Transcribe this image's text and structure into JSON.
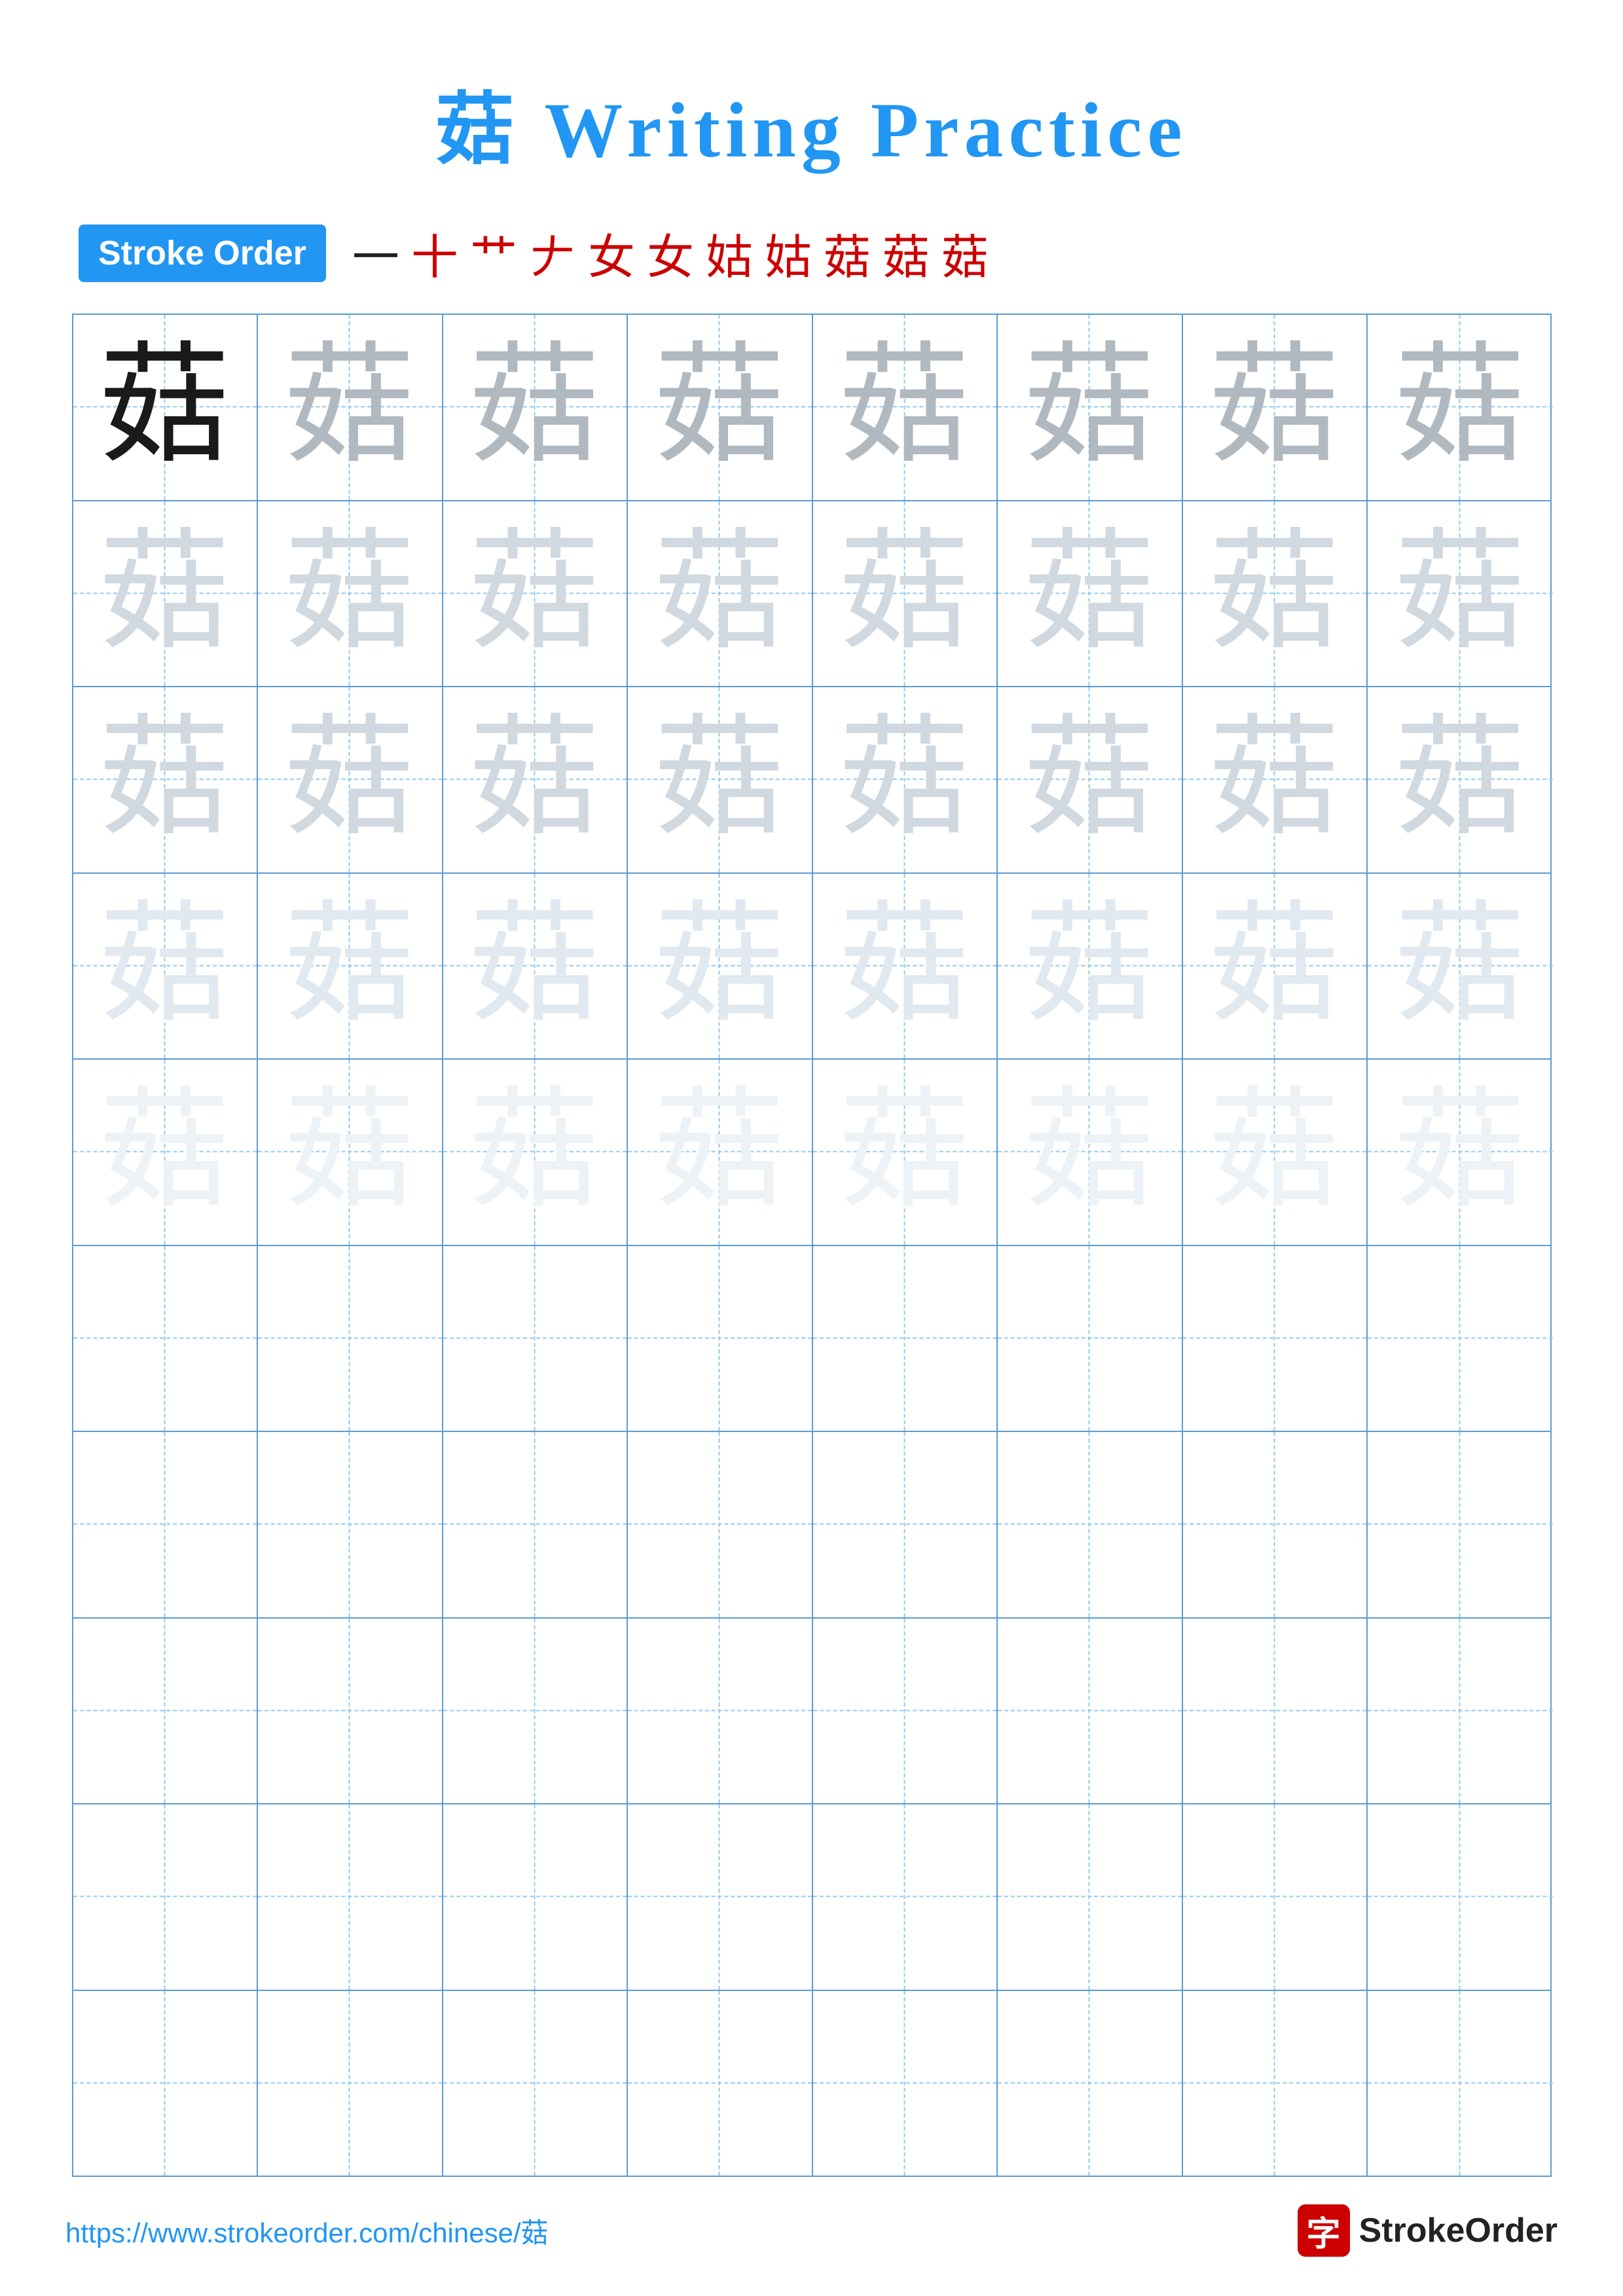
{
  "page": {
    "title": "菇 Writing Practice",
    "character": "菇",
    "stroke_order_label": "Stroke Order",
    "stroke_order_sequence": [
      "一",
      "十",
      "艹",
      "𠂇",
      "女",
      "女",
      "姑",
      "姑",
      "菇",
      "菇",
      "菇"
    ],
    "footer_url": "https://www.strokeorder.com/chinese/菇",
    "footer_logo_char": "字",
    "footer_logo_text": "StrokeOrder",
    "rows": [
      {
        "cells": [
          "dark",
          "medium",
          "medium",
          "medium",
          "medium",
          "medium",
          "medium",
          "medium"
        ]
      },
      {
        "cells": [
          "light",
          "light",
          "light",
          "light",
          "light",
          "light",
          "light",
          "light"
        ]
      },
      {
        "cells": [
          "light",
          "light",
          "light",
          "light",
          "light",
          "light",
          "light",
          "light"
        ]
      },
      {
        "cells": [
          "very-light",
          "very-light",
          "very-light",
          "very-light",
          "very-light",
          "very-light",
          "very-light",
          "very-light"
        ]
      },
      {
        "cells": [
          "faintest",
          "faintest",
          "faintest",
          "faintest",
          "faintest",
          "faintest",
          "faintest",
          "faintest"
        ]
      },
      {
        "cells": [
          "empty",
          "empty",
          "empty",
          "empty",
          "empty",
          "empty",
          "empty",
          "empty"
        ]
      },
      {
        "cells": [
          "empty",
          "empty",
          "empty",
          "empty",
          "empty",
          "empty",
          "empty",
          "empty"
        ]
      },
      {
        "cells": [
          "empty",
          "empty",
          "empty",
          "empty",
          "empty",
          "empty",
          "empty",
          "empty"
        ]
      },
      {
        "cells": [
          "empty",
          "empty",
          "empty",
          "empty",
          "empty",
          "empty",
          "empty",
          "empty"
        ]
      },
      {
        "cells": [
          "empty",
          "empty",
          "empty",
          "empty",
          "empty",
          "empty",
          "empty",
          "empty"
        ]
      }
    ]
  }
}
